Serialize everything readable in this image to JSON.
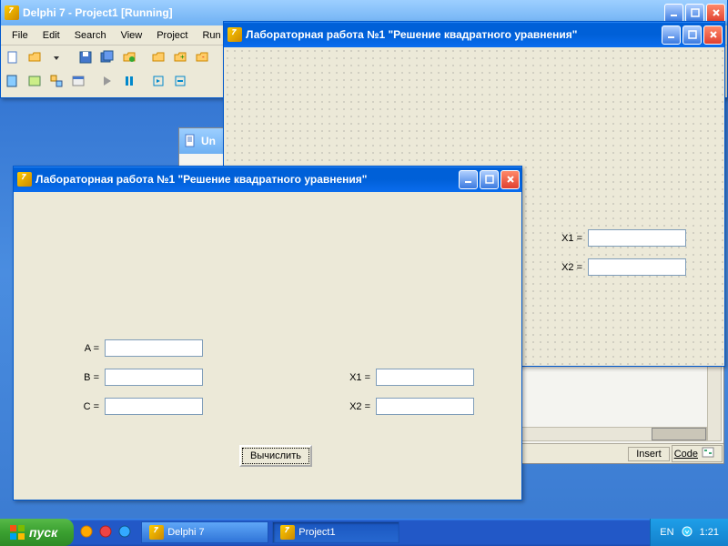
{
  "ide": {
    "title": "Delphi 7 - Project1 [Running]",
    "menu": [
      "File",
      "Edit",
      "Search",
      "View",
      "Project",
      "Run"
    ]
  },
  "unit_window": {
    "title_partial": "Un",
    "status": {
      "insert": "Insert",
      "code_tab": "Code"
    }
  },
  "designer": {
    "title": "Лабораторная работа №1 \"Решение квадратного уравнения\"",
    "labels": {
      "x1": "X1 =",
      "x2": "X2 ="
    }
  },
  "runform": {
    "title": "Лабораторная работа №1 \"Решение квадратного уравнения\"",
    "labels": {
      "a": "A =",
      "b": "B =",
      "c": "C =",
      "x1": "X1 =",
      "x2": "X2 ="
    },
    "values": {
      "a": "",
      "b": "",
      "c": "",
      "x1": "",
      "x2": ""
    },
    "button": "Вычислить"
  },
  "taskbar": {
    "start": "пуск",
    "tasks": [
      {
        "label": "Delphi 7",
        "active": false
      },
      {
        "label": "Project1",
        "active": true
      }
    ],
    "lang": "EN",
    "clock": "1:21"
  }
}
